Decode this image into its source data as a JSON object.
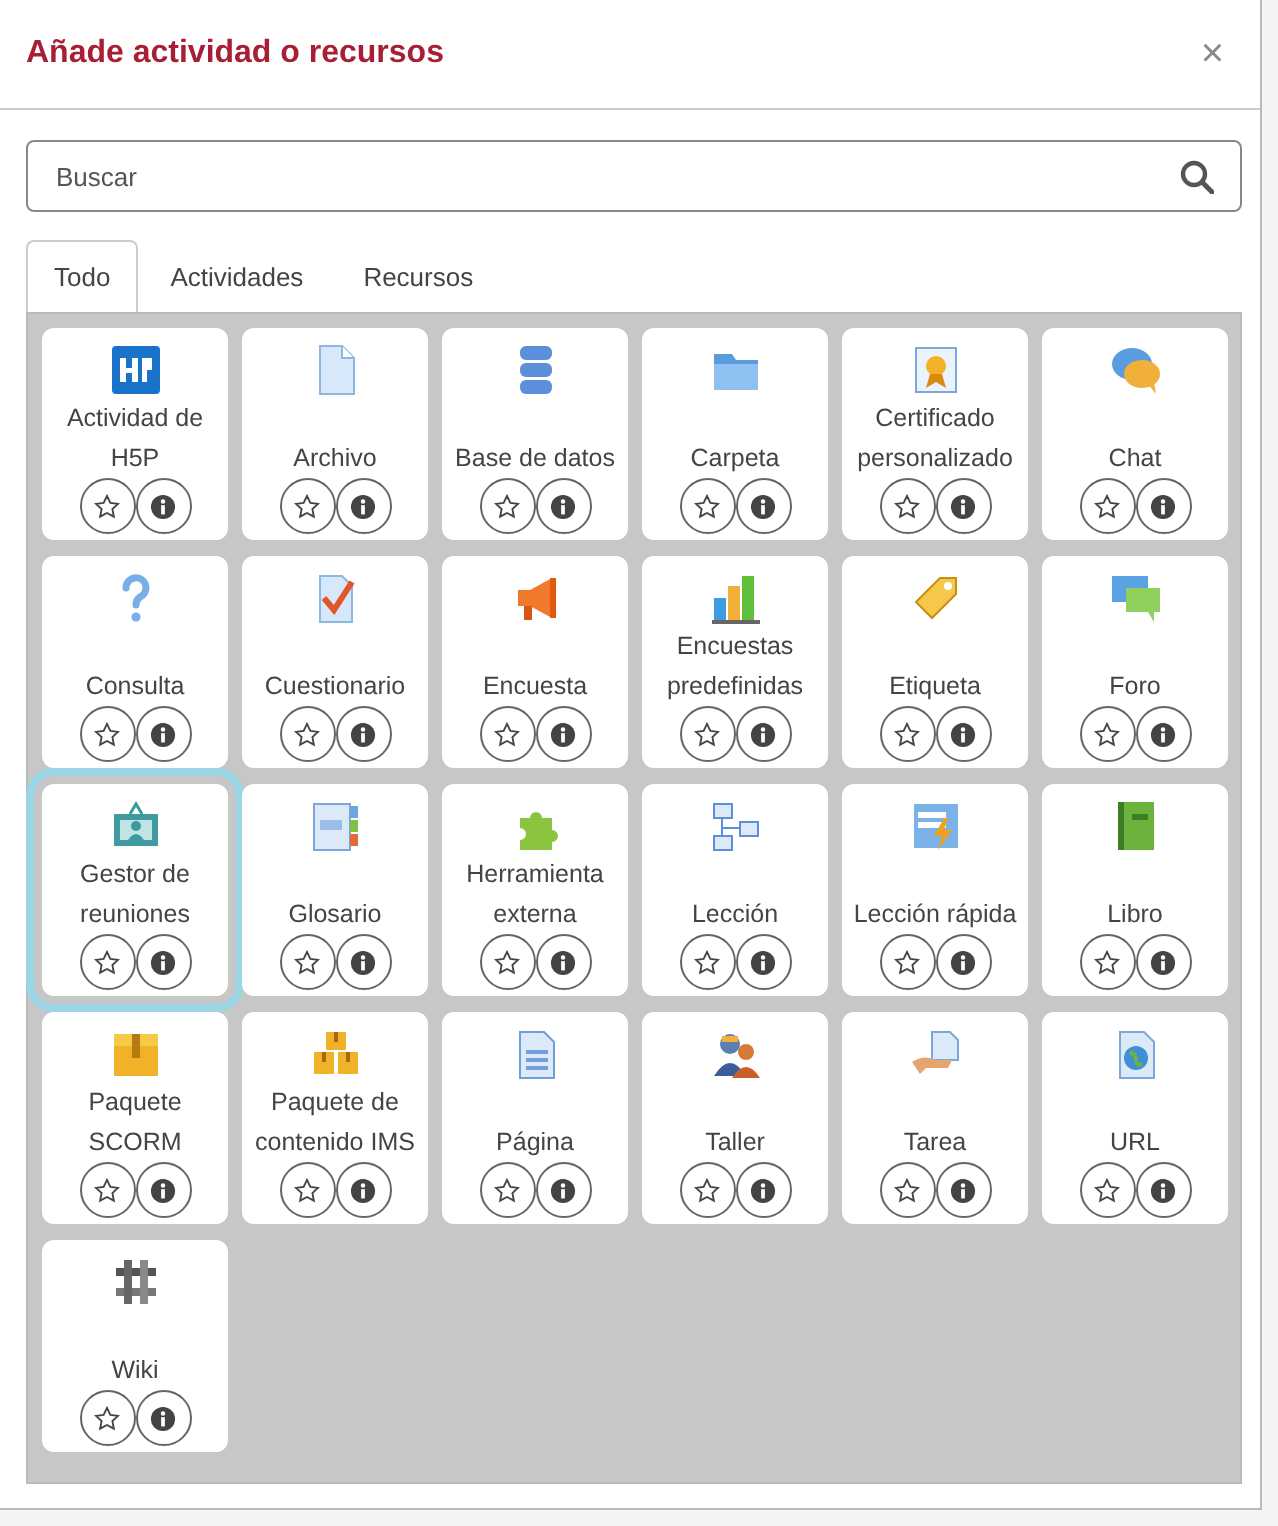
{
  "dialog": {
    "title": "Añade actividad o recursos",
    "close": "×"
  },
  "search": {
    "placeholder": "Buscar"
  },
  "tabs": [
    {
      "label": "Todo",
      "selected": true
    },
    {
      "label": "Actividades",
      "selected": false
    },
    {
      "label": "Recursos",
      "selected": false
    }
  ],
  "items": [
    {
      "label": "Actividad de H5P",
      "selected": false
    },
    {
      "label": "Archivo",
      "selected": false
    },
    {
      "label": "Base de datos",
      "selected": false
    },
    {
      "label": "Carpeta",
      "selected": false
    },
    {
      "label": "Certificado personalizado",
      "selected": false
    },
    {
      "label": "Chat",
      "selected": false
    },
    {
      "label": "Consulta",
      "selected": false
    },
    {
      "label": "Cuestionario",
      "selected": false
    },
    {
      "label": "Encuesta",
      "selected": false
    },
    {
      "label": "Encuestas predefinidas",
      "selected": false
    },
    {
      "label": "Etiqueta",
      "selected": false
    },
    {
      "label": "Foro",
      "selected": false
    },
    {
      "label": "Gestor de reuniones",
      "selected": true
    },
    {
      "label": "Glosario",
      "selected": false
    },
    {
      "label": "Herramienta externa",
      "selected": false
    },
    {
      "label": "Lección",
      "selected": false
    },
    {
      "label": "Lección rápida",
      "selected": false
    },
    {
      "label": "Libro",
      "selected": false
    },
    {
      "label": "Paquete SCORM",
      "selected": false
    },
    {
      "label": "Paquete de contenido IMS",
      "selected": false
    },
    {
      "label": "Página",
      "selected": false
    },
    {
      "label": "Taller",
      "selected": false
    },
    {
      "label": "Tarea",
      "selected": false
    },
    {
      "label": "URL",
      "selected": false
    },
    {
      "label": "Wiki",
      "selected": false
    }
  ]
}
